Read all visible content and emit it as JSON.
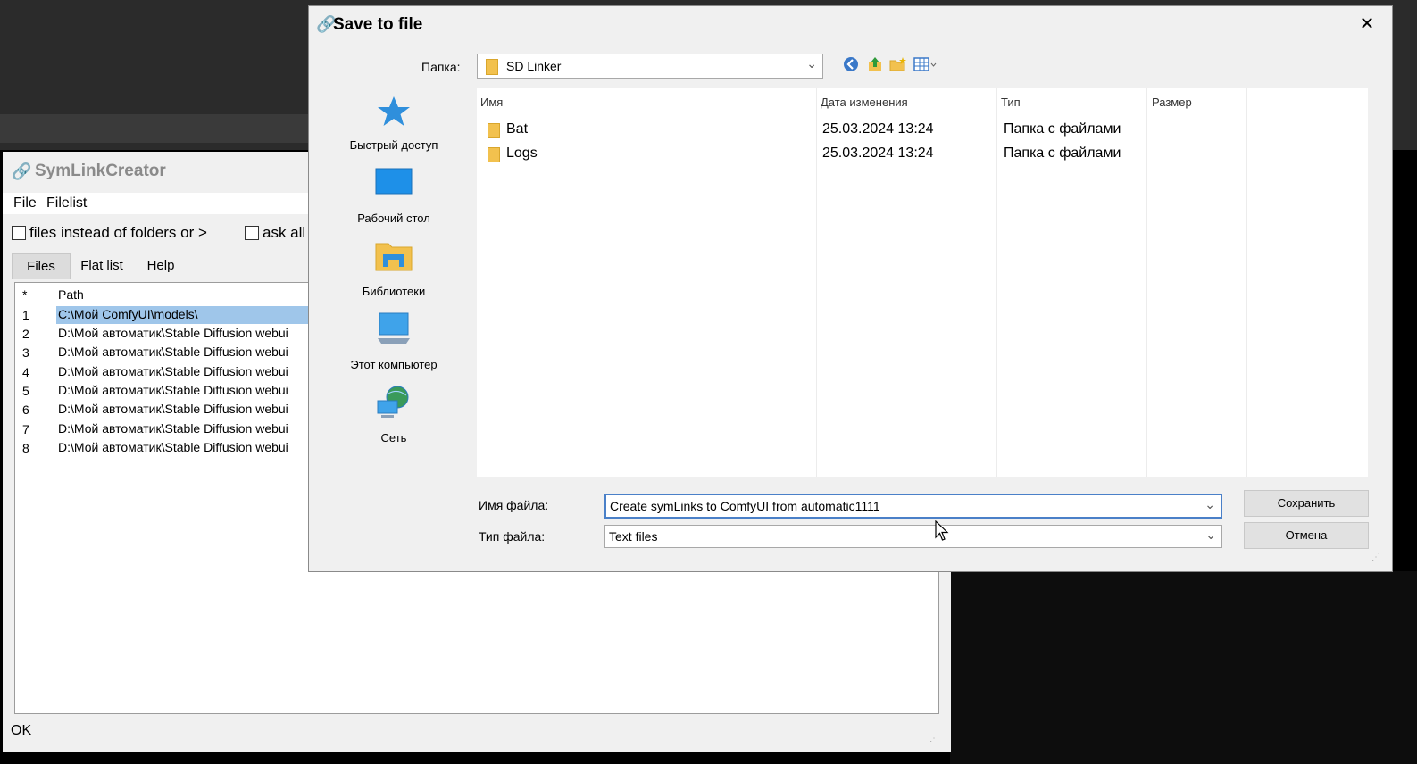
{
  "background": {
    "title_fragment": "Stable Diffusion webui"
  },
  "symlink": {
    "title": "SymLinkCreator",
    "menu": [
      "File",
      "Filelist"
    ],
    "options": {
      "files_instead": "files instead of folders or >",
      "ask_all": "ask all"
    },
    "tabs": [
      "Files",
      "Flat list",
      "Help"
    ],
    "list": {
      "headers": [
        "*",
        "Path"
      ],
      "rows": [
        {
          "num": "1",
          "path": "C:\\Мой ComfyUI\\models\\",
          "selected": true
        },
        {
          "num": "2",
          "path": "D:\\Мой автоматик\\Stable Diffusion webui"
        },
        {
          "num": "3",
          "path": "D:\\Мой автоматик\\Stable Diffusion webui"
        },
        {
          "num": "4",
          "path": "D:\\Мой автоматик\\Stable Diffusion webui"
        },
        {
          "num": "5",
          "path": "D:\\Мой автоматик\\Stable Diffusion webui"
        },
        {
          "num": "6",
          "path": "D:\\Мой автоматик\\Stable Diffusion webui"
        },
        {
          "num": "7",
          "path": "D:\\Мой автоматик\\Stable Diffusion webui"
        },
        {
          "num": "8",
          "path": "D:\\Мой автоматик\\Stable Diffusion webui"
        }
      ]
    },
    "status": "OK"
  },
  "dialog": {
    "title": "Save to file",
    "close": "✕",
    "folder_label": "Папка:",
    "folder_value": "SD Linker",
    "places": [
      {
        "label": "Быстрый доступ",
        "icon": "star-icon"
      },
      {
        "label": "Рабочий стол",
        "icon": "desktop-icon"
      },
      {
        "label": "Библиотеки",
        "icon": "libraries-icon"
      },
      {
        "label": "Этот компьютер",
        "icon": "computer-icon"
      },
      {
        "label": "Сеть",
        "icon": "network-icon"
      }
    ],
    "columns": [
      "Имя",
      "Дата изменения",
      "Тип",
      "Размер"
    ],
    "files": [
      {
        "name": "Bat",
        "date": "25.03.2024 13:24",
        "type": "Папка с файлами",
        "size": ""
      },
      {
        "name": "Logs",
        "date": "25.03.2024 13:24",
        "type": "Папка с файлами",
        "size": ""
      }
    ],
    "filename_label": "Имя файла:",
    "filename_value": "Create symLinks to ComfyUI from automatic1111",
    "filetype_label": "Тип файла:",
    "filetype_value": "Text files",
    "save_label": "Сохранить",
    "cancel_label": "Отмена"
  }
}
